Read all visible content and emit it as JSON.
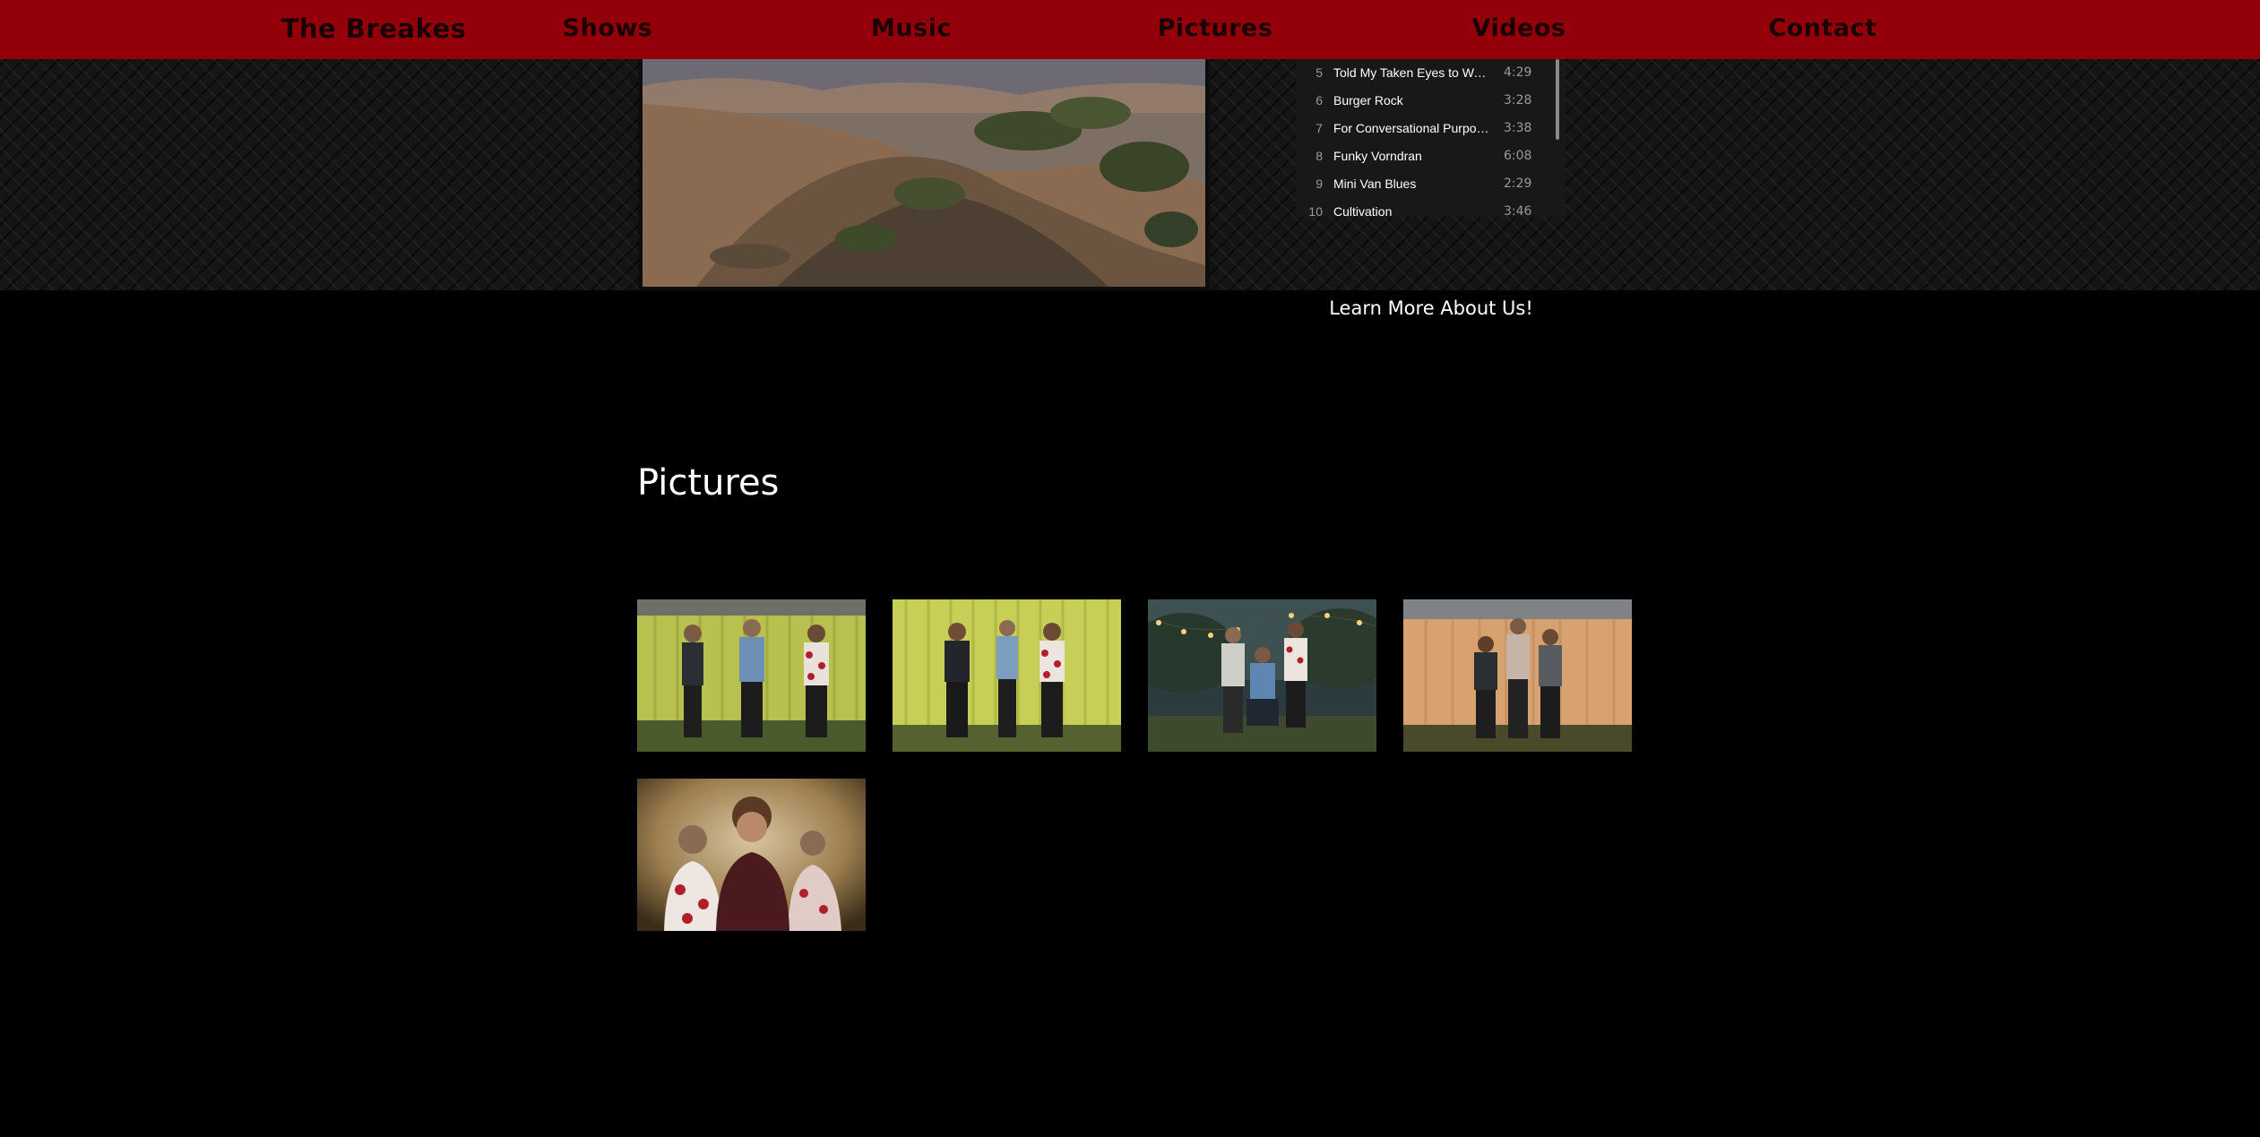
{
  "nav": {
    "brand": "The Breakes",
    "items": [
      {
        "label": "Shows"
      },
      {
        "label": "Music"
      },
      {
        "label": "Pictures"
      },
      {
        "label": "Videos"
      },
      {
        "label": "Contact"
      }
    ]
  },
  "playlist": {
    "tracks": [
      {
        "num": "5",
        "title": "Told My Taken Eyes to Wan...",
        "duration": "4:29"
      },
      {
        "num": "6",
        "title": "Burger Rock",
        "duration": "3:28"
      },
      {
        "num": "7",
        "title": "For Conversational Purposes",
        "duration": "3:38"
      },
      {
        "num": "8",
        "title": "Funky Vorndran",
        "duration": "6:08"
      },
      {
        "num": "9",
        "title": "Mini Van Blues",
        "duration": "2:29"
      },
      {
        "num": "10",
        "title": "Cultivation",
        "duration": "3:46"
      }
    ]
  },
  "learn_more": "Learn More About Us!",
  "pictures": {
    "title": "Pictures",
    "photos": [
      {
        "name": "band-photo-yellow-wall-1"
      },
      {
        "name": "band-photo-yellow-wall-2"
      },
      {
        "name": "band-photo-string-lights"
      },
      {
        "name": "band-photo-orange-wall"
      },
      {
        "name": "band-photo-portrait"
      }
    ]
  },
  "colors": {
    "nav_bg": "#94000a",
    "nav_text": "#1a0003",
    "page_bg": "#000000",
    "playlist_bg": "#181818"
  }
}
